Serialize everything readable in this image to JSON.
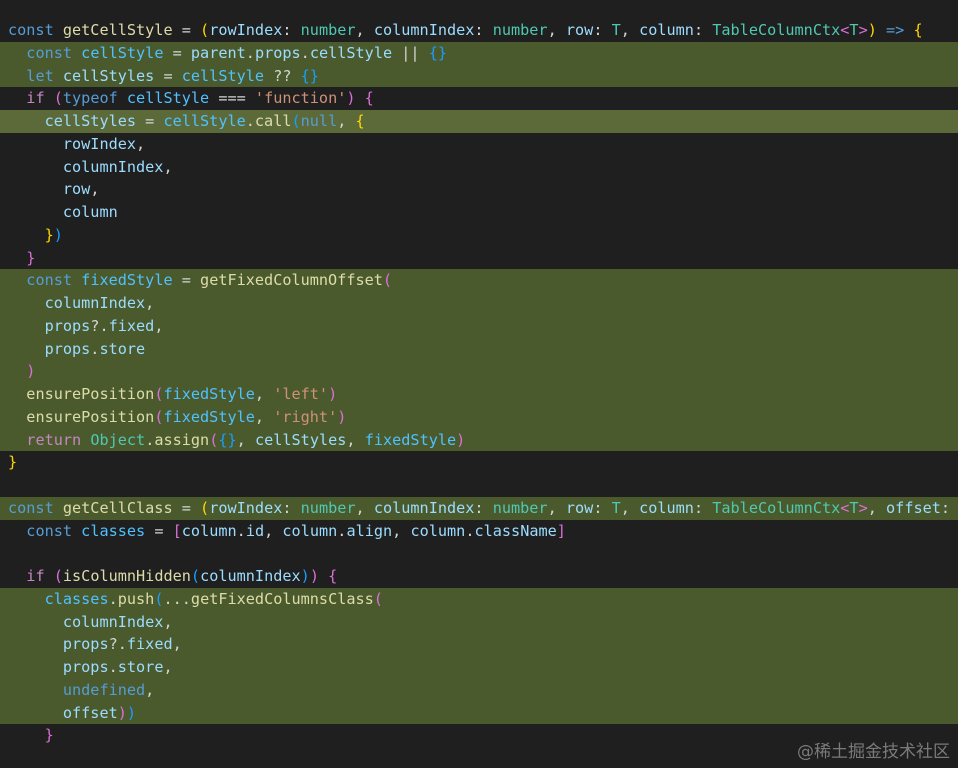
{
  "editor": {
    "lines": [
      {
        "hl": "none",
        "t": [
          [
            "const ",
            "kw"
          ],
          [
            "getCellStyle",
            "fn"
          ],
          [
            " = ",
            "op"
          ],
          [
            "(",
            "b1"
          ],
          [
            "rowIndex",
            "prm"
          ],
          [
            ": ",
            "pun"
          ],
          [
            "number",
            "type"
          ],
          [
            ", ",
            "pun"
          ],
          [
            "columnIndex",
            "prm"
          ],
          [
            ": ",
            "pun"
          ],
          [
            "number",
            "type"
          ],
          [
            ", ",
            "pun"
          ],
          [
            "row",
            "prm"
          ],
          [
            ": ",
            "pun"
          ],
          [
            "T",
            "type"
          ],
          [
            ", ",
            "pun"
          ],
          [
            "column",
            "prm"
          ],
          [
            ": ",
            "pun"
          ],
          [
            "TableColumnCtx",
            "type"
          ],
          [
            "<",
            "b2"
          ],
          [
            "T",
            "type"
          ],
          [
            ">",
            "b2"
          ],
          [
            ")",
            "b1"
          ],
          [
            " => ",
            "kw"
          ],
          [
            "{",
            "b1"
          ]
        ]
      },
      {
        "hl": "hl",
        "t": [
          [
            "  "
          ],
          [
            "const ",
            "kw"
          ],
          [
            "cellStyle",
            "const"
          ],
          [
            " = ",
            "op"
          ],
          [
            "parent",
            "var"
          ],
          [
            ".",
            "pun"
          ],
          [
            "props",
            "var"
          ],
          [
            ".",
            "pun"
          ],
          [
            "cellStyle",
            "var"
          ],
          [
            " || ",
            "op"
          ],
          [
            "{}",
            "b3"
          ]
        ]
      },
      {
        "hl": "hl",
        "t": [
          [
            "  "
          ],
          [
            "let ",
            "kw"
          ],
          [
            "cellStyles",
            "var"
          ],
          [
            " = ",
            "op"
          ],
          [
            "cellStyle",
            "const"
          ],
          [
            " ?? ",
            "op"
          ],
          [
            "{}",
            "b3"
          ]
        ]
      },
      {
        "hl": "none",
        "t": [
          [
            "  "
          ],
          [
            "if ",
            "ctrl"
          ],
          [
            "(",
            "b2"
          ],
          [
            "typeof ",
            "kw"
          ],
          [
            "cellStyle",
            "const"
          ],
          [
            " === ",
            "op"
          ],
          [
            "'function'",
            "str"
          ],
          [
            ")",
            "b2"
          ],
          [
            " {",
            "b2"
          ]
        ]
      },
      {
        "hl": "cur",
        "t": [
          [
            "    "
          ],
          [
            "cellStyles",
            "var"
          ],
          [
            " = ",
            "op"
          ],
          [
            "cellStyle",
            "const"
          ],
          [
            ".",
            "pun"
          ],
          [
            "call",
            "fn"
          ],
          [
            "(",
            "b3"
          ],
          [
            "null",
            "kw"
          ],
          [
            ", ",
            "pun"
          ],
          [
            "{",
            "b1"
          ]
        ]
      },
      {
        "hl": "none",
        "t": [
          [
            "      "
          ],
          [
            "rowIndex",
            "var"
          ],
          [
            ",",
            "pun"
          ]
        ]
      },
      {
        "hl": "none",
        "t": [
          [
            "      "
          ],
          [
            "columnIndex",
            "var"
          ],
          [
            ",",
            "pun"
          ]
        ]
      },
      {
        "hl": "none",
        "t": [
          [
            "      "
          ],
          [
            "row",
            "var"
          ],
          [
            ",",
            "pun"
          ]
        ]
      },
      {
        "hl": "none",
        "t": [
          [
            "      "
          ],
          [
            "column",
            "var"
          ]
        ]
      },
      {
        "hl": "none",
        "t": [
          [
            "    "
          ],
          [
            "}",
            "b1"
          ],
          [
            ")",
            "b3"
          ]
        ]
      },
      {
        "hl": "none",
        "t": [
          [
            "  "
          ],
          [
            "}",
            "b2"
          ]
        ]
      },
      {
        "hl": "hl",
        "t": [
          [
            "  "
          ],
          [
            "const ",
            "kw"
          ],
          [
            "fixedStyle",
            "const"
          ],
          [
            " = ",
            "op"
          ],
          [
            "getFixedColumnOffset",
            "fn"
          ],
          [
            "(",
            "b2"
          ]
        ]
      },
      {
        "hl": "hl",
        "t": [
          [
            "    "
          ],
          [
            "columnIndex",
            "var"
          ],
          [
            ",",
            "pun"
          ]
        ]
      },
      {
        "hl": "hl",
        "t": [
          [
            "    "
          ],
          [
            "props",
            "var"
          ],
          [
            "?.",
            "pun"
          ],
          [
            "fixed",
            "var"
          ],
          [
            ",",
            "pun"
          ]
        ]
      },
      {
        "hl": "hl",
        "t": [
          [
            "    "
          ],
          [
            "props",
            "var"
          ],
          [
            ".",
            "pun"
          ],
          [
            "store",
            "var"
          ]
        ]
      },
      {
        "hl": "hl",
        "t": [
          [
            "  "
          ],
          [
            ")",
            "b2"
          ]
        ]
      },
      {
        "hl": "hl",
        "t": [
          [
            "  "
          ],
          [
            "ensurePosition",
            "fn"
          ],
          [
            "(",
            "b2"
          ],
          [
            "fixedStyle",
            "const"
          ],
          [
            ", ",
            "pun"
          ],
          [
            "'left'",
            "str"
          ],
          [
            ")",
            "b2"
          ]
        ]
      },
      {
        "hl": "hl",
        "t": [
          [
            "  "
          ],
          [
            "ensurePosition",
            "fn"
          ],
          [
            "(",
            "b2"
          ],
          [
            "fixedStyle",
            "const"
          ],
          [
            ", ",
            "pun"
          ],
          [
            "'right'",
            "str"
          ],
          [
            ")",
            "b2"
          ]
        ]
      },
      {
        "hl": "hl",
        "t": [
          [
            "  "
          ],
          [
            "return ",
            "ctrl"
          ],
          [
            "Object",
            "type"
          ],
          [
            ".",
            "pun"
          ],
          [
            "assign",
            "fn"
          ],
          [
            "(",
            "b2"
          ],
          [
            "{}",
            "b3"
          ],
          [
            ", ",
            "pun"
          ],
          [
            "cellStyles",
            "var"
          ],
          [
            ", ",
            "pun"
          ],
          [
            "fixedStyle",
            "const"
          ],
          [
            ")",
            "b2"
          ]
        ]
      },
      {
        "hl": "none",
        "t": [
          [
            "}",
            "b1"
          ]
        ]
      },
      {
        "hl": "none",
        "t": []
      },
      {
        "hl": "hl",
        "t": [
          [
            "const ",
            "kw"
          ],
          [
            "getCellClass",
            "fn"
          ],
          [
            " = ",
            "op"
          ],
          [
            "(",
            "b1"
          ],
          [
            "rowIndex",
            "prm"
          ],
          [
            ": ",
            "pun"
          ],
          [
            "number",
            "type"
          ],
          [
            ", ",
            "pun"
          ],
          [
            "columnIndex",
            "prm"
          ],
          [
            ": ",
            "pun"
          ],
          [
            "number",
            "type"
          ],
          [
            ", ",
            "pun"
          ],
          [
            "row",
            "prm"
          ],
          [
            ": ",
            "pun"
          ],
          [
            "T",
            "type"
          ],
          [
            ", ",
            "pun"
          ],
          [
            "column",
            "prm"
          ],
          [
            ": ",
            "pun"
          ],
          [
            "TableColumnCtx",
            "type"
          ],
          [
            "<",
            "b2"
          ],
          [
            "T",
            "type"
          ],
          [
            ">",
            "b2"
          ],
          [
            ", ",
            "pun"
          ],
          [
            "offset",
            "prm"
          ],
          [
            ":",
            "pun"
          ]
        ]
      },
      {
        "hl": "none",
        "t": [
          [
            "  "
          ],
          [
            "const ",
            "kw"
          ],
          [
            "classes",
            "const"
          ],
          [
            " = ",
            "op"
          ],
          [
            "[",
            "b2"
          ],
          [
            "column",
            "var"
          ],
          [
            ".",
            "pun"
          ],
          [
            "id",
            "var"
          ],
          [
            ", ",
            "pun"
          ],
          [
            "column",
            "var"
          ],
          [
            ".",
            "pun"
          ],
          [
            "align",
            "var"
          ],
          [
            ", ",
            "pun"
          ],
          [
            "column",
            "var"
          ],
          [
            ".",
            "pun"
          ],
          [
            "className",
            "var"
          ],
          [
            "]",
            "b2"
          ]
        ]
      },
      {
        "hl": "none",
        "t": []
      },
      {
        "hl": "none",
        "t": [
          [
            "  "
          ],
          [
            "if ",
            "ctrl"
          ],
          [
            "(",
            "b2"
          ],
          [
            "isColumnHidden",
            "fn"
          ],
          [
            "(",
            "b3"
          ],
          [
            "columnIndex",
            "var"
          ],
          [
            ")",
            "b3"
          ],
          [
            ")",
            "b2"
          ],
          [
            " {",
            "b2"
          ]
        ]
      },
      {
        "hl": "hl",
        "t": [
          [
            "    "
          ],
          [
            "classes",
            "const"
          ],
          [
            ".",
            "pun"
          ],
          [
            "push",
            "fn"
          ],
          [
            "(",
            "b3"
          ],
          [
            "...",
            "op"
          ],
          [
            "getFixedColumnsClass",
            "fn"
          ],
          [
            "(",
            "b2"
          ]
        ]
      },
      {
        "hl": "hl",
        "t": [
          [
            "      "
          ],
          [
            "columnIndex",
            "var"
          ],
          [
            ",",
            "pun"
          ]
        ]
      },
      {
        "hl": "hl",
        "t": [
          [
            "      "
          ],
          [
            "props",
            "var"
          ],
          [
            "?.",
            "pun"
          ],
          [
            "fixed",
            "var"
          ],
          [
            ",",
            "pun"
          ]
        ]
      },
      {
        "hl": "hl",
        "t": [
          [
            "      "
          ],
          [
            "props",
            "var"
          ],
          [
            ".",
            "pun"
          ],
          [
            "store",
            "var"
          ],
          [
            ",",
            "pun"
          ]
        ]
      },
      {
        "hl": "hl",
        "t": [
          [
            "      "
          ],
          [
            "undefined",
            "kw"
          ],
          [
            ",",
            "pun"
          ]
        ]
      },
      {
        "hl": "hl",
        "t": [
          [
            "      "
          ],
          [
            "offset",
            "var"
          ],
          [
            ")",
            "b2"
          ],
          [
            ")",
            "b3"
          ]
        ]
      },
      {
        "hl": "none",
        "t": [
          [
            "    "
          ],
          [
            "}",
            "b2"
          ]
        ]
      }
    ]
  },
  "watermark": "@稀土掘金技术社区"
}
